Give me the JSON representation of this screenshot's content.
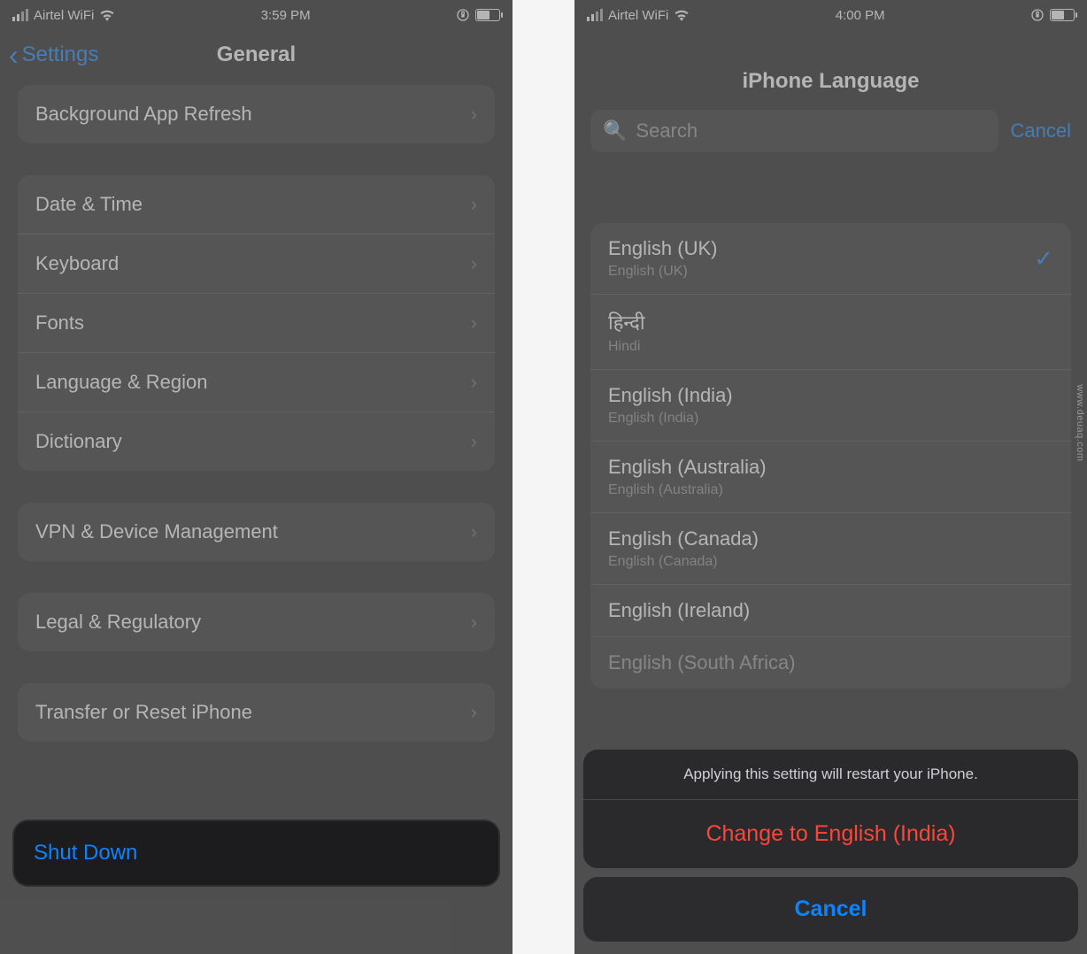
{
  "left": {
    "status": {
      "carrier": "Airtel WiFi",
      "time": "3:59 PM"
    },
    "nav": {
      "back": "Settings",
      "title": "General"
    },
    "groups": [
      {
        "rows": [
          {
            "label": "Background App Refresh"
          }
        ]
      },
      {
        "rows": [
          {
            "label": "Date & Time"
          },
          {
            "label": "Keyboard"
          },
          {
            "label": "Fonts"
          },
          {
            "label": "Language & Region"
          },
          {
            "label": "Dictionary"
          }
        ]
      },
      {
        "rows": [
          {
            "label": "VPN & Device Management"
          }
        ]
      },
      {
        "rows": [
          {
            "label": "Legal & Regulatory"
          }
        ]
      },
      {
        "rows": [
          {
            "label": "Transfer or Reset iPhone"
          }
        ]
      }
    ],
    "shutdown": "Shut Down"
  },
  "right": {
    "status": {
      "carrier": "Airtel WiFi",
      "time": "4:00 PM"
    },
    "title": "iPhone Language",
    "search": {
      "placeholder": "Search",
      "cancel": "Cancel"
    },
    "languages": [
      {
        "native": "English (UK)",
        "sub": "English (UK)",
        "selected": true
      },
      {
        "native": "हिन्दी",
        "sub": "Hindi"
      },
      {
        "native": "English (India)",
        "sub": "English (India)"
      },
      {
        "native": "English (Australia)",
        "sub": "English (Australia)"
      },
      {
        "native": "English (Canada)",
        "sub": "English (Canada)"
      },
      {
        "native": "English (Ireland)",
        "sub": ""
      },
      {
        "native": "English (South Africa)",
        "sub": ""
      }
    ],
    "sheet": {
      "message": "Applying this setting will restart your iPhone.",
      "action": "Change to English (India)",
      "cancel": "Cancel"
    }
  },
  "watermark": "www.deuaq.com"
}
